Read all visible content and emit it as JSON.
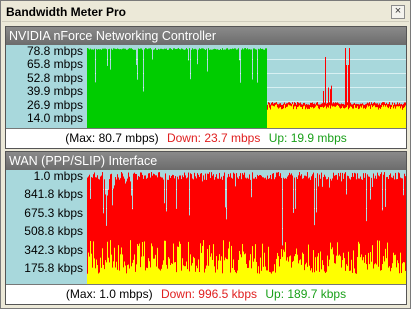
{
  "window": {
    "title": "Bandwidth Meter Pro",
    "close_glyph": "×"
  },
  "panels": [
    {
      "header": "NVIDIA nForce Networking Controller",
      "y_labels": [
        "78.8 mbps",
        "65.8 mbps",
        "52.8 mbps",
        "39.9 mbps",
        "26.9 mbps",
        "14.0 mbps"
      ],
      "footer": {
        "max": "(Max: 80.7 mbps)",
        "down": "Down: 23.7 mbps",
        "up": "Up: 19.9 mbps"
      }
    },
    {
      "header": "WAN (PPP/SLIP) Interface",
      "y_labels": [
        "1.0 mbps",
        "841.8 kbps",
        "675.3 kbps",
        "508.8 kbps",
        "342.3 kbps",
        "175.8 kbps"
      ],
      "footer": {
        "max": "(Max: 1.0 mbps)",
        "down": "Down: 996.5 kbps",
        "up": "Up: 189.7 kbps"
      }
    }
  ],
  "colors": {
    "plot_bg": "#a8d8dc",
    "down": "#ff0000",
    "up": "#ffff00",
    "total": "#00cc00",
    "grid": "#d8f0f2",
    "header_bg": "#777777"
  }
}
